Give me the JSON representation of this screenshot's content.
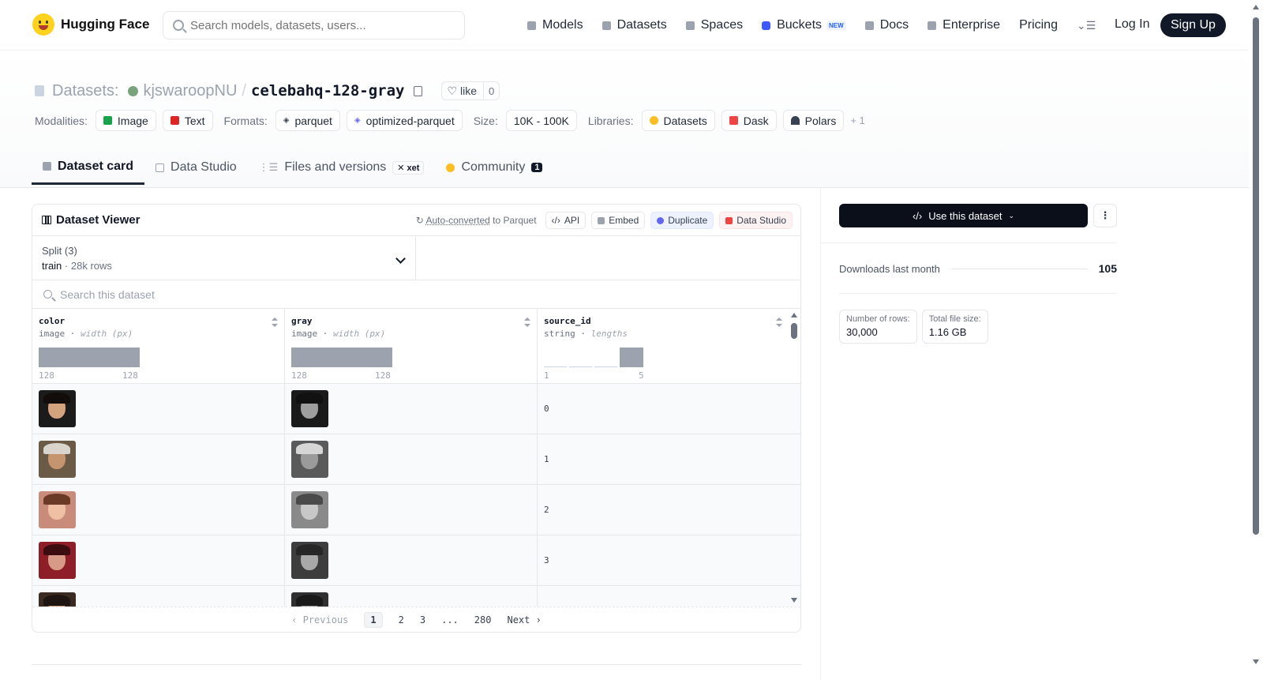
{
  "nav": {
    "brand": "Hugging Face",
    "search_placeholder": "Search models, datasets, users...",
    "links": [
      {
        "label": "Models",
        "icon": "models-icon"
      },
      {
        "label": "Datasets",
        "icon": "datasets-icon"
      },
      {
        "label": "Spaces",
        "icon": "spaces-icon"
      },
      {
        "label": "Buckets",
        "icon": "buckets-icon",
        "badge": "NEW"
      },
      {
        "label": "Docs",
        "icon": "docs-icon"
      },
      {
        "label": "Enterprise",
        "icon": "enterprise-icon"
      },
      {
        "label": "Pricing"
      }
    ],
    "login": "Log In",
    "signup": "Sign Up"
  },
  "header": {
    "section": "Datasets:",
    "owner": "kjswaroopNU",
    "separator": "/",
    "repo": "celebahq-128-gray",
    "like_label": "like",
    "like_count": "0"
  },
  "meta": {
    "modalities_label": "Modalities:",
    "modalities": [
      "Image",
      "Text"
    ],
    "formats_label": "Formats:",
    "formats": [
      "parquet",
      "optimized-parquet"
    ],
    "size_label": "Size:",
    "size": "10K - 100K",
    "libraries_label": "Libraries:",
    "libraries": [
      "Datasets",
      "Dask",
      "Polars"
    ],
    "more": "+ 1"
  },
  "tabs": {
    "dataset_card": "Dataset card",
    "data_studio": "Data Studio",
    "files": "Files and versions",
    "xet": "xet",
    "community": "Community",
    "community_count": "1"
  },
  "viewer": {
    "title": "Dataset Viewer",
    "auto_converted": "Auto-converted",
    "to_parquet": "to Parquet",
    "api": "API",
    "embed": "Embed",
    "duplicate": "Duplicate",
    "data_studio": "Data Studio",
    "split_label": "Split (3)",
    "split_value": "train",
    "split_rows": "28k rows",
    "search_placeholder": "Search this dataset",
    "columns": [
      {
        "name": "color",
        "type": "image",
        "stat": "width (px)",
        "min": "128",
        "max": "128"
      },
      {
        "name": "gray",
        "type": "image",
        "stat": "width (px)",
        "min": "128",
        "max": "128"
      },
      {
        "name": "source_id",
        "type": "string",
        "stat": "lengths",
        "min": "1",
        "max": "5"
      }
    ],
    "rows": [
      "0",
      "1",
      "2",
      "3"
    ],
    "pager": {
      "prev": "Previous",
      "p1": "1",
      "p2": "2",
      "p3": "3",
      "ellipsis": "...",
      "last": "280",
      "next": "Next"
    }
  },
  "sidebar": {
    "use_button": "Use this dataset",
    "downloads_label": "Downloads last month",
    "downloads_value": "105",
    "rows_label": "Number of rows:",
    "rows_value": "30,000",
    "size_label": "Total file size:",
    "size_value": "1.16 GB"
  }
}
